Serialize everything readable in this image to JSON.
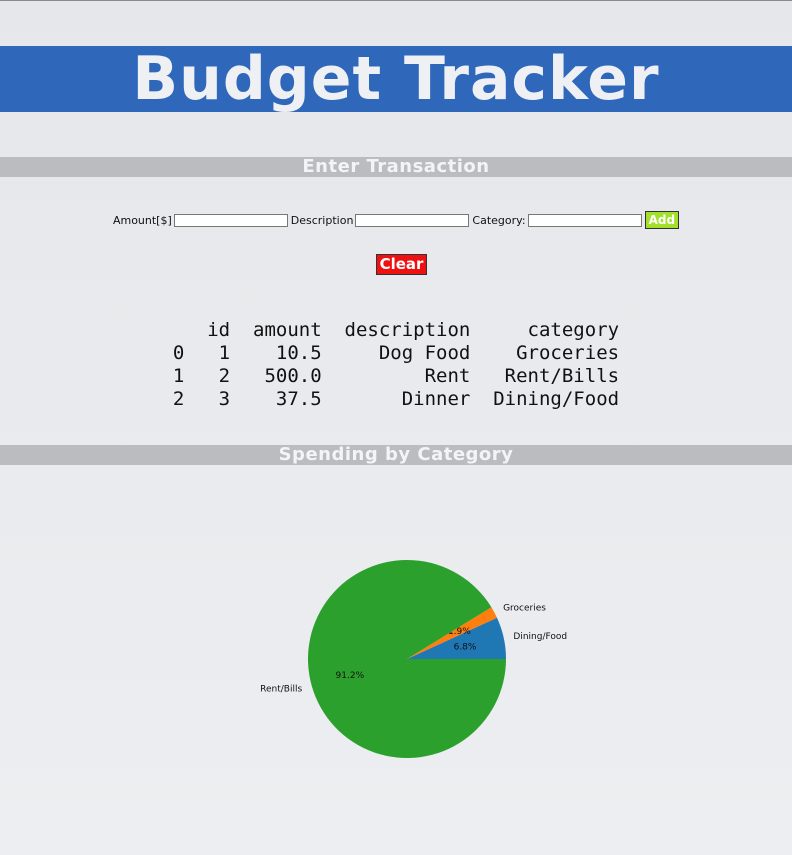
{
  "header": {
    "title": "Budget Tracker"
  },
  "sections": {
    "enter_transaction": "Enter Transaction",
    "spending_by_category": "Spending by Category"
  },
  "form": {
    "amount_label": "Amount[$]",
    "amount_value": "",
    "description_label": "Description",
    "description_value": "",
    "category_label": "Category:",
    "category_value": "",
    "add_label": "Add",
    "clear_label": "Clear"
  },
  "table": {
    "columns": [
      "",
      "id",
      "amount",
      "description",
      "category"
    ],
    "rows": [
      [
        "0",
        "1",
        "10.5",
        "Dog Food",
        "Groceries"
      ],
      [
        "1",
        "2",
        "500.0",
        "Rent",
        "Rent/Bills"
      ],
      [
        "2",
        "3",
        "37.5",
        "Dinner",
        "Dining/Food"
      ]
    ]
  },
  "colors": {
    "banner": "#2f68bb",
    "section_bar": "#bbbcbf",
    "add_button": "#a3e02b",
    "clear_button": "#ee1111"
  },
  "chart_data": {
    "type": "pie",
    "title": "",
    "slices": [
      {
        "label": "Dining/Food",
        "value": 37.5,
        "pct_label": "6.8%",
        "color": "#1f77b4"
      },
      {
        "label": "Groceries",
        "value": 10.5,
        "pct_label": "1.9%",
        "color": "#ff7f0e"
      },
      {
        "label": "Rent/Bills",
        "value": 500.0,
        "pct_label": "91.2%",
        "color": "#2ca02c"
      }
    ],
    "start_angle": 0,
    "direction": "counterclockwise"
  }
}
